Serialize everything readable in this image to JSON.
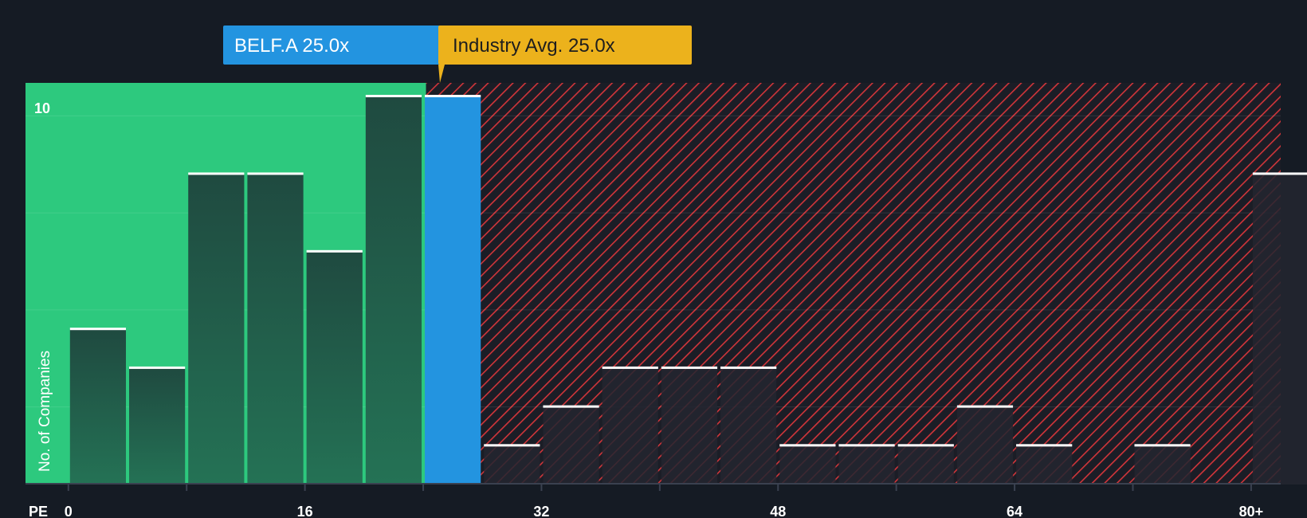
{
  "chart_data": {
    "type": "bar",
    "xlabel": "PE",
    "ylabel": "No. of Companies",
    "x_ticks": [
      "0",
      "16",
      "32",
      "48",
      "64",
      "80+"
    ],
    "x_tick_values": [
      0,
      16,
      32,
      48,
      64,
      80
    ],
    "y_tick_label": "10",
    "y_tick_value": 10,
    "ylim": [
      0,
      10.35
    ],
    "xlim": [
      -2.9,
      82
    ],
    "bin_width": 4,
    "bins": [
      {
        "start": 0,
        "value": 4,
        "zone": "below"
      },
      {
        "start": 4,
        "value": 3,
        "zone": "below"
      },
      {
        "start": 8,
        "value": 8,
        "zone": "below"
      },
      {
        "start": 12,
        "value": 8,
        "zone": "below"
      },
      {
        "start": 16,
        "value": 6,
        "zone": "below"
      },
      {
        "start": 20,
        "value": 10,
        "zone": "below"
      },
      {
        "start": 24,
        "value": 10,
        "zone": "company"
      },
      {
        "start": 28,
        "value": 1,
        "zone": "above"
      },
      {
        "start": 32,
        "value": 2,
        "zone": "above"
      },
      {
        "start": 36,
        "value": 3,
        "zone": "above"
      },
      {
        "start": 40,
        "value": 3,
        "zone": "above"
      },
      {
        "start": 44,
        "value": 3,
        "zone": "above"
      },
      {
        "start": 48,
        "value": 1,
        "zone": "above"
      },
      {
        "start": 52,
        "value": 1,
        "zone": "above"
      },
      {
        "start": 56,
        "value": 1,
        "zone": "above"
      },
      {
        "start": 60,
        "value": 2,
        "zone": "above"
      },
      {
        "start": 64,
        "value": 1,
        "zone": "above"
      },
      {
        "start": 68,
        "value": 0,
        "zone": "above"
      },
      {
        "start": 72,
        "value": 1,
        "zone": "above"
      },
      {
        "start": 76,
        "value": 0,
        "zone": "above"
      },
      {
        "start": 80,
        "value": 8,
        "zone": "above"
      }
    ],
    "company": {
      "label": "BELF.A 25.0x",
      "value": 25.0
    },
    "industry_avg": {
      "label": "Industry Avg. 25.0x",
      "value": 25.0
    },
    "grid": true,
    "colors": {
      "background": "#151b24",
      "below_zone": "#2dc97e",
      "below_bar_top": "#1f4a40",
      "below_bar_bottom": "#247255",
      "company_bar": "#2394e0",
      "above_hatch": "#d1353a",
      "above_bar": "#232630",
      "cap": "#ffffff",
      "company_callout": "#2394e0",
      "industry_callout": "#ecb21c"
    }
  }
}
